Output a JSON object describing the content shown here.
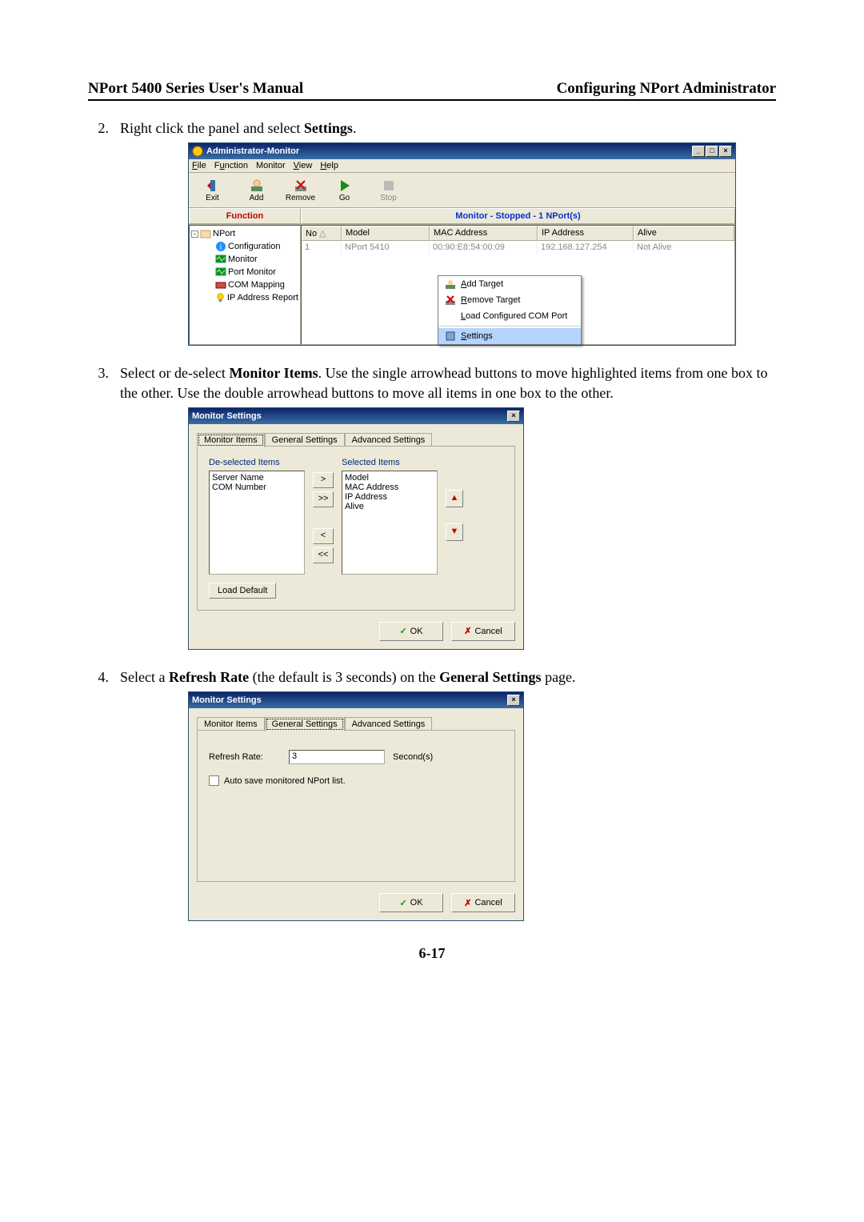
{
  "page": {
    "header_left": "NPort 5400 Series User's Manual",
    "header_right": "Configuring NPort Administrator",
    "page_number": "6-17"
  },
  "steps": {
    "s2_num": "2.",
    "s2_text_a": "Right click the panel and select ",
    "s2_bold": "Settings",
    "s2_text_b": ".",
    "s3_num": "3.",
    "s3_text_a": "Select or de-select ",
    "s3_bold": "Monitor Items",
    "s3_text_b": ". Use the single arrowhead buttons to move highlighted items from one box to the other. Use the double arrowhead buttons to move all items in one box to the other.",
    "s4_num": "4.",
    "s4_text_a": "Select a ",
    "s4_bold1": "Refresh Rate",
    "s4_text_b": " (the default is 3 seconds) on the ",
    "s4_bold2": "General Settings",
    "s4_text_c": " page."
  },
  "win1": {
    "title": "Administrator-Monitor",
    "menu": {
      "file": "File",
      "function": "Function",
      "monitor": "Monitor",
      "view": "View",
      "help": "Help"
    },
    "toolbar": {
      "exit": "Exit",
      "add": "Add",
      "remove": "Remove",
      "go": "Go",
      "stop": "Stop"
    },
    "func_label": "Function",
    "monitor_status": "Monitor - Stopped - 1 NPort(s)",
    "tree": {
      "root": "NPort",
      "config": "Configuration",
      "monitor": "Monitor",
      "pmon": "Port Monitor",
      "commap": "COM Mapping",
      "ipreport": "IP Address Report"
    },
    "columns": {
      "no": "No",
      "model": "Model",
      "mac": "MAC Address",
      "ip": "IP Address",
      "alive": "Alive"
    },
    "row1": {
      "no": "1",
      "model": "NPort 5410",
      "mac": "00:90:E8:54:00:09",
      "ip": "192.168.127.254",
      "alive": "Not Alive"
    },
    "ctx": {
      "add": "Add Target",
      "remove": "Remove Target",
      "load": "Load Configured COM Port",
      "settings": "Settings"
    }
  },
  "dlg2": {
    "title": "Monitor Settings",
    "tabs": {
      "monitems": "Monitor Items",
      "general": "General Settings",
      "advanced": "Advanced Settings"
    },
    "deselected_label": "De-selected Items",
    "selected_label": "Selected Items",
    "deselected_items": [
      "Server Name",
      "COM Number"
    ],
    "selected_items": [
      "Model",
      "MAC Address",
      "IP Address",
      "Alive"
    ],
    "move": {
      "right": ">",
      "all_right": ">>",
      "left": "<",
      "all_left": "<<"
    },
    "updown": {
      "up": "▲",
      "down": "▼"
    },
    "load_default": "Load Default",
    "ok": "OK",
    "cancel": "Cancel"
  },
  "dlg3": {
    "title": "Monitor Settings",
    "tabs": {
      "monitems": "Monitor Items",
      "general": "General Settings",
      "advanced": "Advanced Settings"
    },
    "refresh_label": "Refresh Rate:",
    "refresh_value": "3",
    "seconds_label": "Second(s)",
    "autosave_label": "Auto save monitored NPort list.",
    "ok": "OK",
    "cancel": "Cancel"
  }
}
